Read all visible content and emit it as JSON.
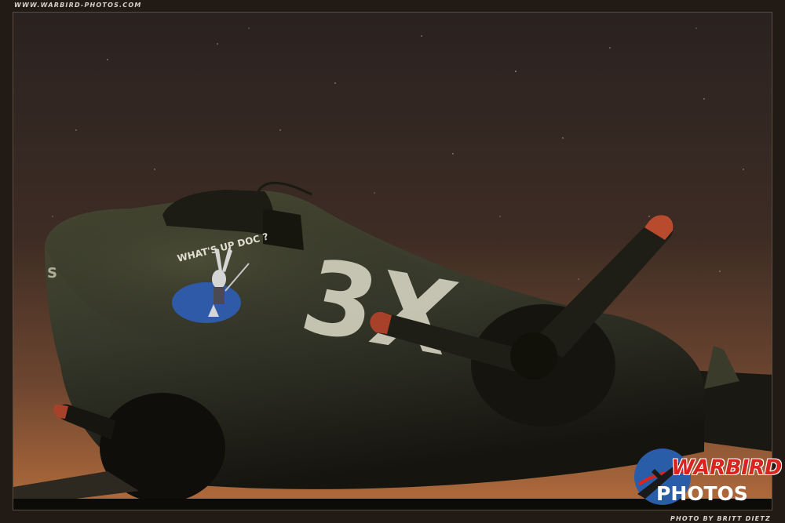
{
  "header": {
    "site_caption": "WWW.WARBIRD-PHOTOS.COM"
  },
  "photo": {
    "nose_art_text": "WHAT'S UP DOC ?",
    "fuselage_code": "3X",
    "nose_letter": "S"
  },
  "footer": {
    "credit": "PHOTO BY BRITT DIETZ"
  },
  "logo": {
    "word_1": "WARBIRD",
    "word_2": "PHOTOS"
  },
  "colors": {
    "sky_top": "#2b2320",
    "sky_horizon": "#b06a3a",
    "aircraft_olive": "#3a3b28",
    "logo_red": "#d8251f",
    "logo_blue": "#2a5da8"
  }
}
